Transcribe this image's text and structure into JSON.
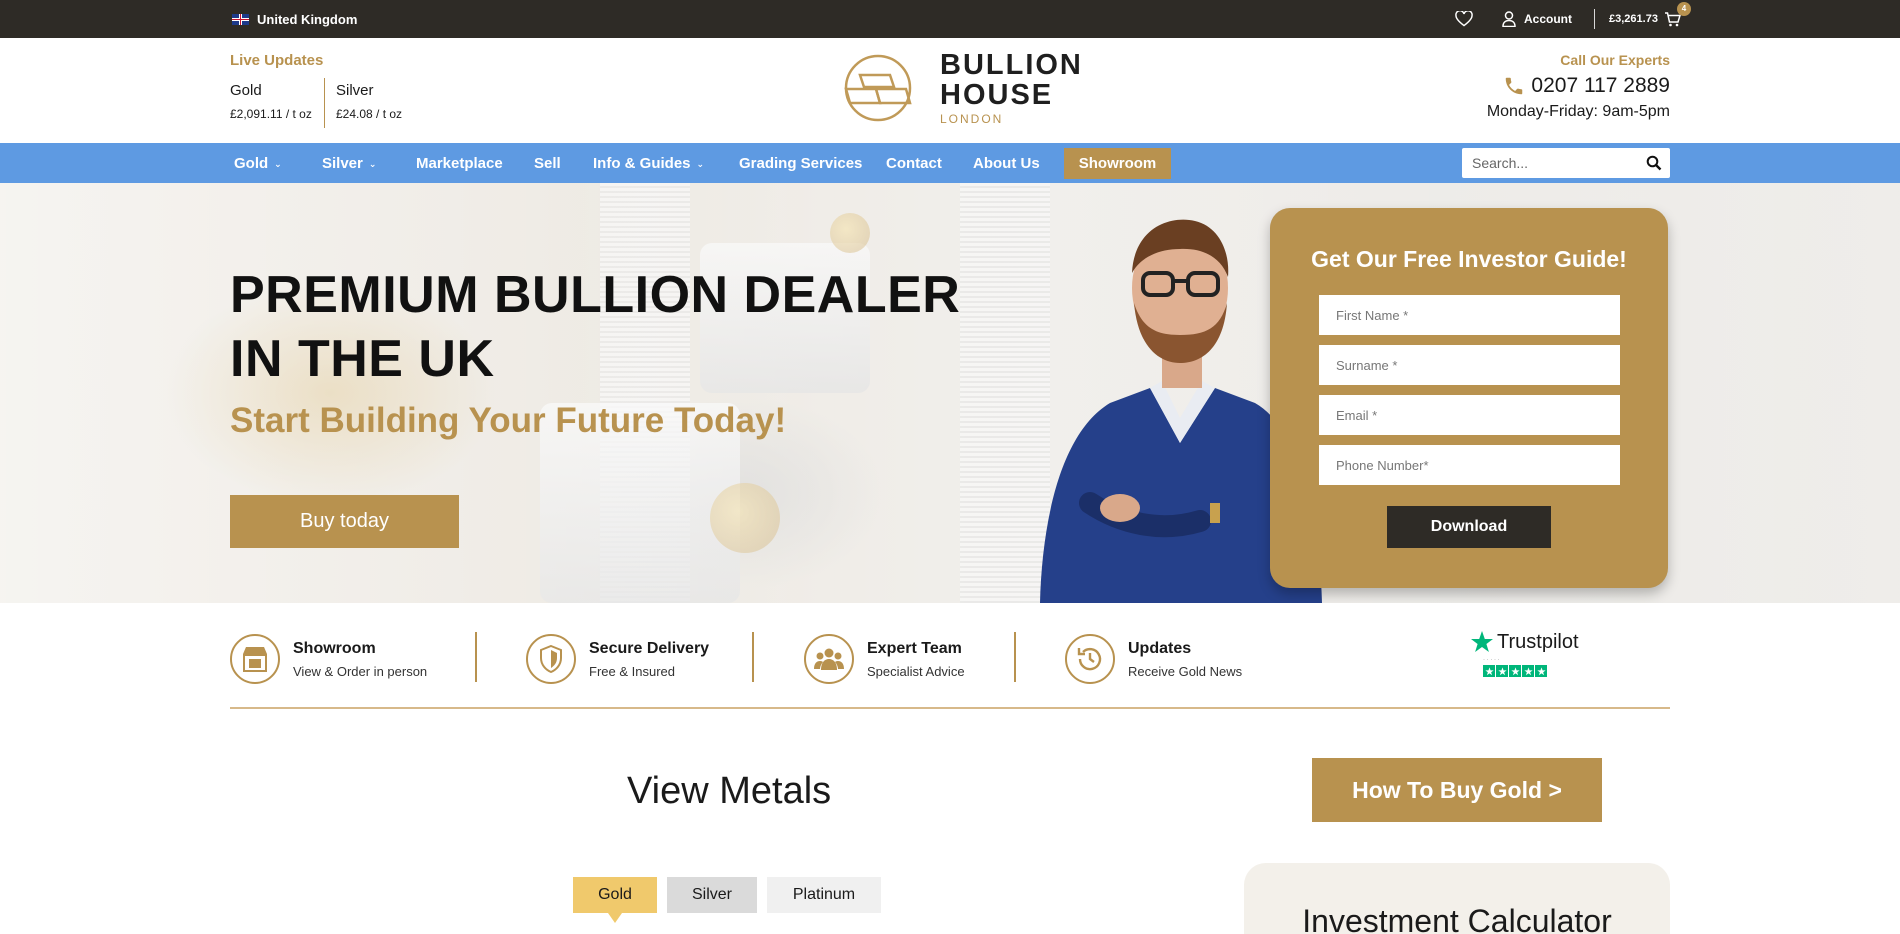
{
  "topbar": {
    "region": "United Kingdom",
    "account_label": "Account",
    "cart_total": "£3,261.73",
    "cart_count": "4"
  },
  "header": {
    "live_updates": "Live Updates",
    "prices": [
      {
        "metal": "Gold",
        "value": "£2,091.11 / t oz"
      },
      {
        "metal": "Silver",
        "value": "£24.08 / t oz"
      }
    ],
    "logo": {
      "line1": "BULLION",
      "line2": "HOUSE",
      "line3": "LONDON"
    },
    "call_title": "Call Our Experts",
    "phone": "0207 117 2889",
    "hours": "Monday-Friday: 9am-5pm"
  },
  "nav": {
    "items": [
      {
        "label": "Gold",
        "dropdown": true
      },
      {
        "label": "Silver",
        "dropdown": true
      },
      {
        "label": "Marketplace",
        "dropdown": false
      },
      {
        "label": "Sell",
        "dropdown": false
      },
      {
        "label": "Info & Guides",
        "dropdown": true
      },
      {
        "label": "Grading Services",
        "dropdown": false
      },
      {
        "label": "Contact",
        "dropdown": false
      },
      {
        "label": "About Us",
        "dropdown": false
      }
    ],
    "showroom": "Showroom",
    "search_placeholder": "Search..."
  },
  "hero": {
    "title": "PREMIUM BULLION DEALER IN THE UK",
    "subtitle": "Start Building Your Future Today!",
    "cta": "Buy today",
    "form": {
      "title": "Get Our Free Investor Guide!",
      "first_name": "First Name *",
      "surname": "Surname *",
      "email": "Email *",
      "phone": "Phone Number*",
      "submit": "Download"
    }
  },
  "features": [
    {
      "title": "Showroom",
      "sub": "View & Order in person",
      "icon": "storefront-icon"
    },
    {
      "title": "Secure Delivery",
      "sub": "Free & Insured",
      "icon": "shield-icon"
    },
    {
      "title": "Expert Team",
      "sub": "Specialist Advice",
      "icon": "team-icon"
    },
    {
      "title": "Updates",
      "sub": "Receive Gold News",
      "icon": "clock-icon"
    }
  ],
  "trustpilot": {
    "name": "Trustpilot",
    "rating_stars": 5
  },
  "metals": {
    "title": "View Metals",
    "how_to_buy": "How To Buy Gold >",
    "tabs": [
      "Gold",
      "Silver",
      "Platinum"
    ],
    "active_tab": "Gold",
    "calculator_title": "Investment Calculator"
  },
  "colors": {
    "accent": "#b8924f",
    "nav": "#5e9ae2",
    "topbar": "#2e2b26",
    "trustpilot": "#00b67a"
  }
}
